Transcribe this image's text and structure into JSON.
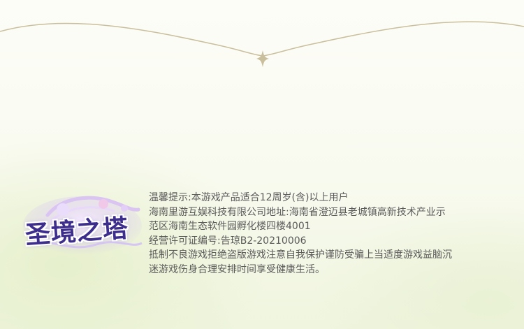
{
  "logo": {
    "title": "圣境之塔",
    "colors": {
      "primary": "#3d2d8c",
      "glow": "#b9a8f0",
      "accent": "#e8c7f2"
    }
  },
  "notice": {
    "lines": [
      "温馨提示:本游戏产品适合12周岁(含)以上用户",
      "海南里游互娱科技有限公司地址:海南省澄迈县老城镇高新技术产业示",
      "范区海南生态软件园孵化楼四楼4001",
      "经营许可证编号:告琼B2-20210006",
      "抵制不良游戏拒绝盗版游戏注意自我保护谨防受骗上当适度游戏益脑沉",
      "迷游戏伤身合理安排时间享受健康生活。"
    ]
  },
  "decor": {
    "ornament_icon": "four-point-star-icon",
    "line_color": "#c9bf9c"
  }
}
